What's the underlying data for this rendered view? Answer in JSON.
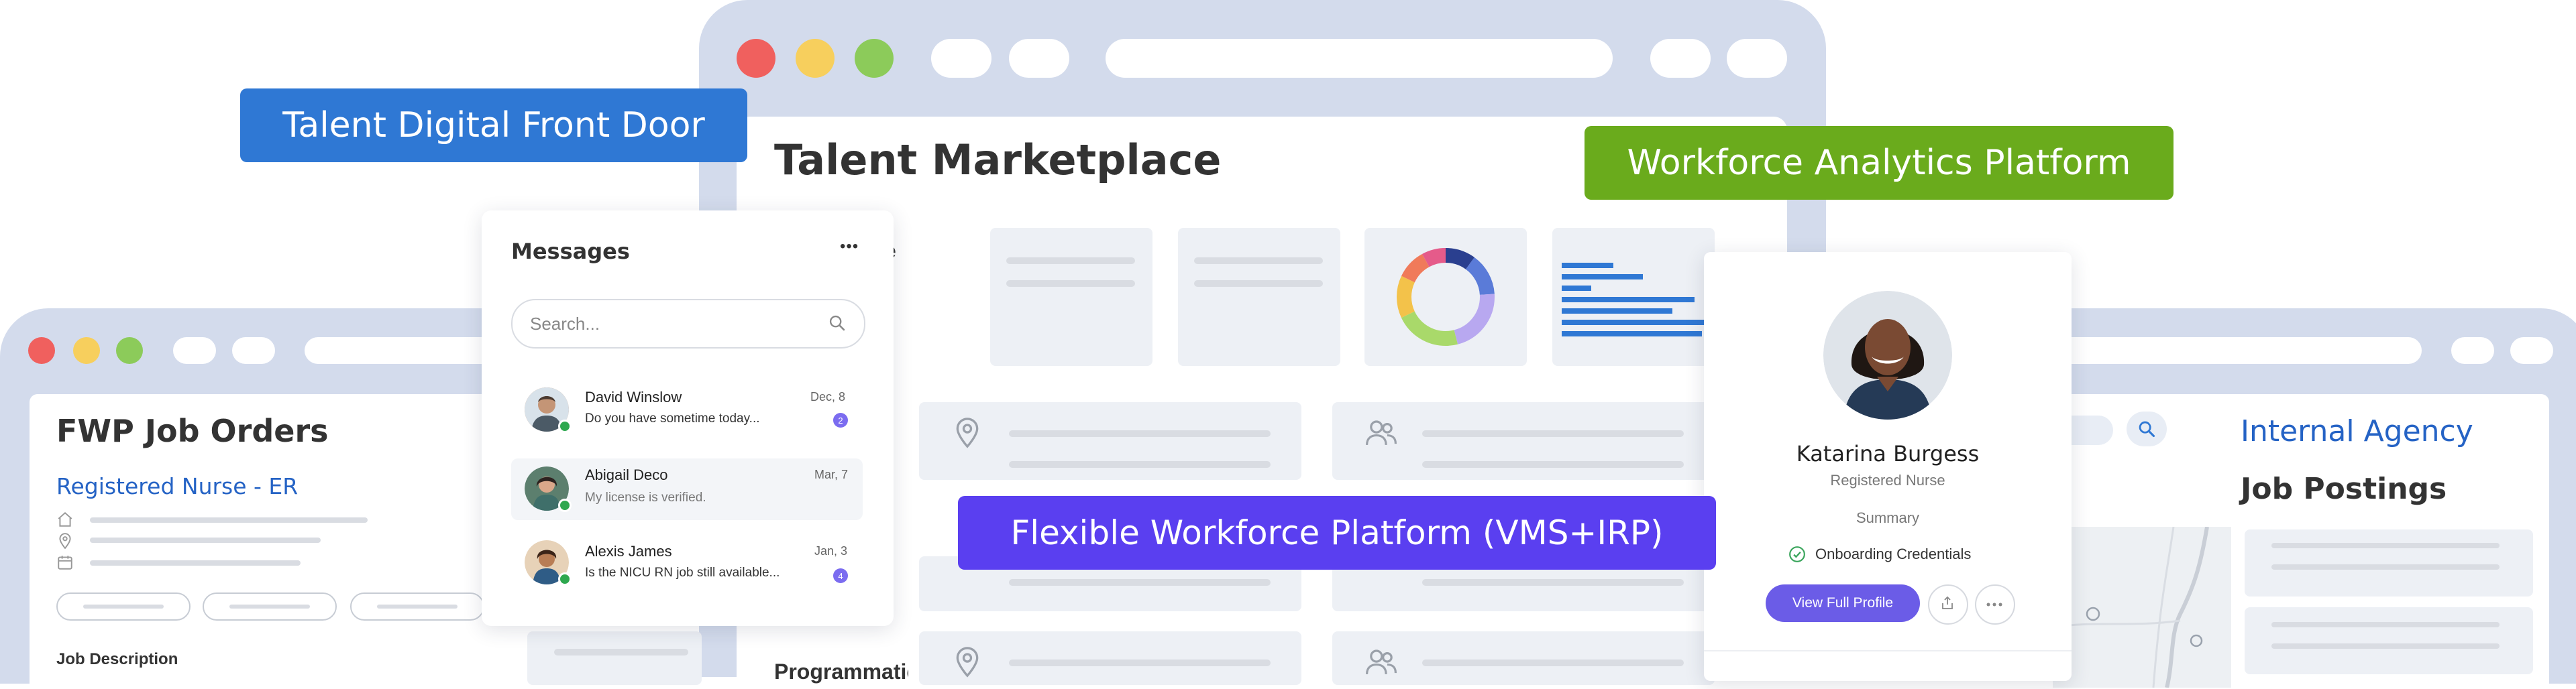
{
  "labels": {
    "talent_front_door": "Talent Digital Front Door",
    "workforce_analytics": "Workforce Analytics Platform",
    "flexible_workforce": "Flexible Workforce Platform (VMS+IRP)"
  },
  "marketplace": {
    "title": "Talent Marketplace",
    "partial_label": "e",
    "partial_bottom_label": "Programmatic"
  },
  "job_orders": {
    "title": "FWP Job Orders",
    "job_title": "Registered Nurse - ER",
    "section_label": "Job Description"
  },
  "messages": {
    "title": "Messages",
    "more_label": "•••",
    "search_placeholder": "Search...",
    "items": [
      {
        "name": "David Winslow",
        "date": "Dec, 8",
        "preview": "Do you have sometime today...",
        "badge": "2",
        "unread": true
      },
      {
        "name": "Abigail Deco",
        "date": "Mar, 7",
        "preview": "My license is verified.",
        "badge": "",
        "unread": false
      },
      {
        "name": "Alexis James",
        "date": "Jan, 3",
        "preview": "Is the NICU RN job still available...",
        "badge": "4",
        "unread": true
      }
    ]
  },
  "profile": {
    "name": "Katarina Burgess",
    "role": "Registered Nurse",
    "summary_label": "Summary",
    "credential_status": "Onboarding Credentials",
    "view_button": "View Full Profile"
  },
  "agency": {
    "title_line1": "Internal Agency",
    "title_line2": "Job Postings"
  },
  "colors": {
    "blue_label": "#2f78d4",
    "green_label": "#6aab1c",
    "purple_label": "#5a3ff0",
    "window_frame": "#d3dbec",
    "dot_red": "#f0605e",
    "dot_yellow": "#f7cf5d",
    "dot_green": "#8ccb5a",
    "link_blue": "#2563c5",
    "button_purple": "#6b5ce7"
  },
  "donut": {
    "segments": [
      {
        "share": 0.1,
        "color": "#2a3f8f"
      },
      {
        "share": 0.14,
        "color": "#5a7bd8"
      },
      {
        "share": 0.22,
        "color": "#b8a8f0"
      },
      {
        "share": 0.22,
        "color": "#a9d96a"
      },
      {
        "share": 0.14,
        "color": "#f3c24a"
      },
      {
        "share": 0.1,
        "color": "#f07a5a"
      },
      {
        "share": 0.08,
        "color": "#e55b8a"
      }
    ]
  },
  "mini_bars": {
    "values": [
      0.35,
      0.55,
      0.2,
      0.9,
      0.75,
      1.0,
      0.95
    ]
  }
}
